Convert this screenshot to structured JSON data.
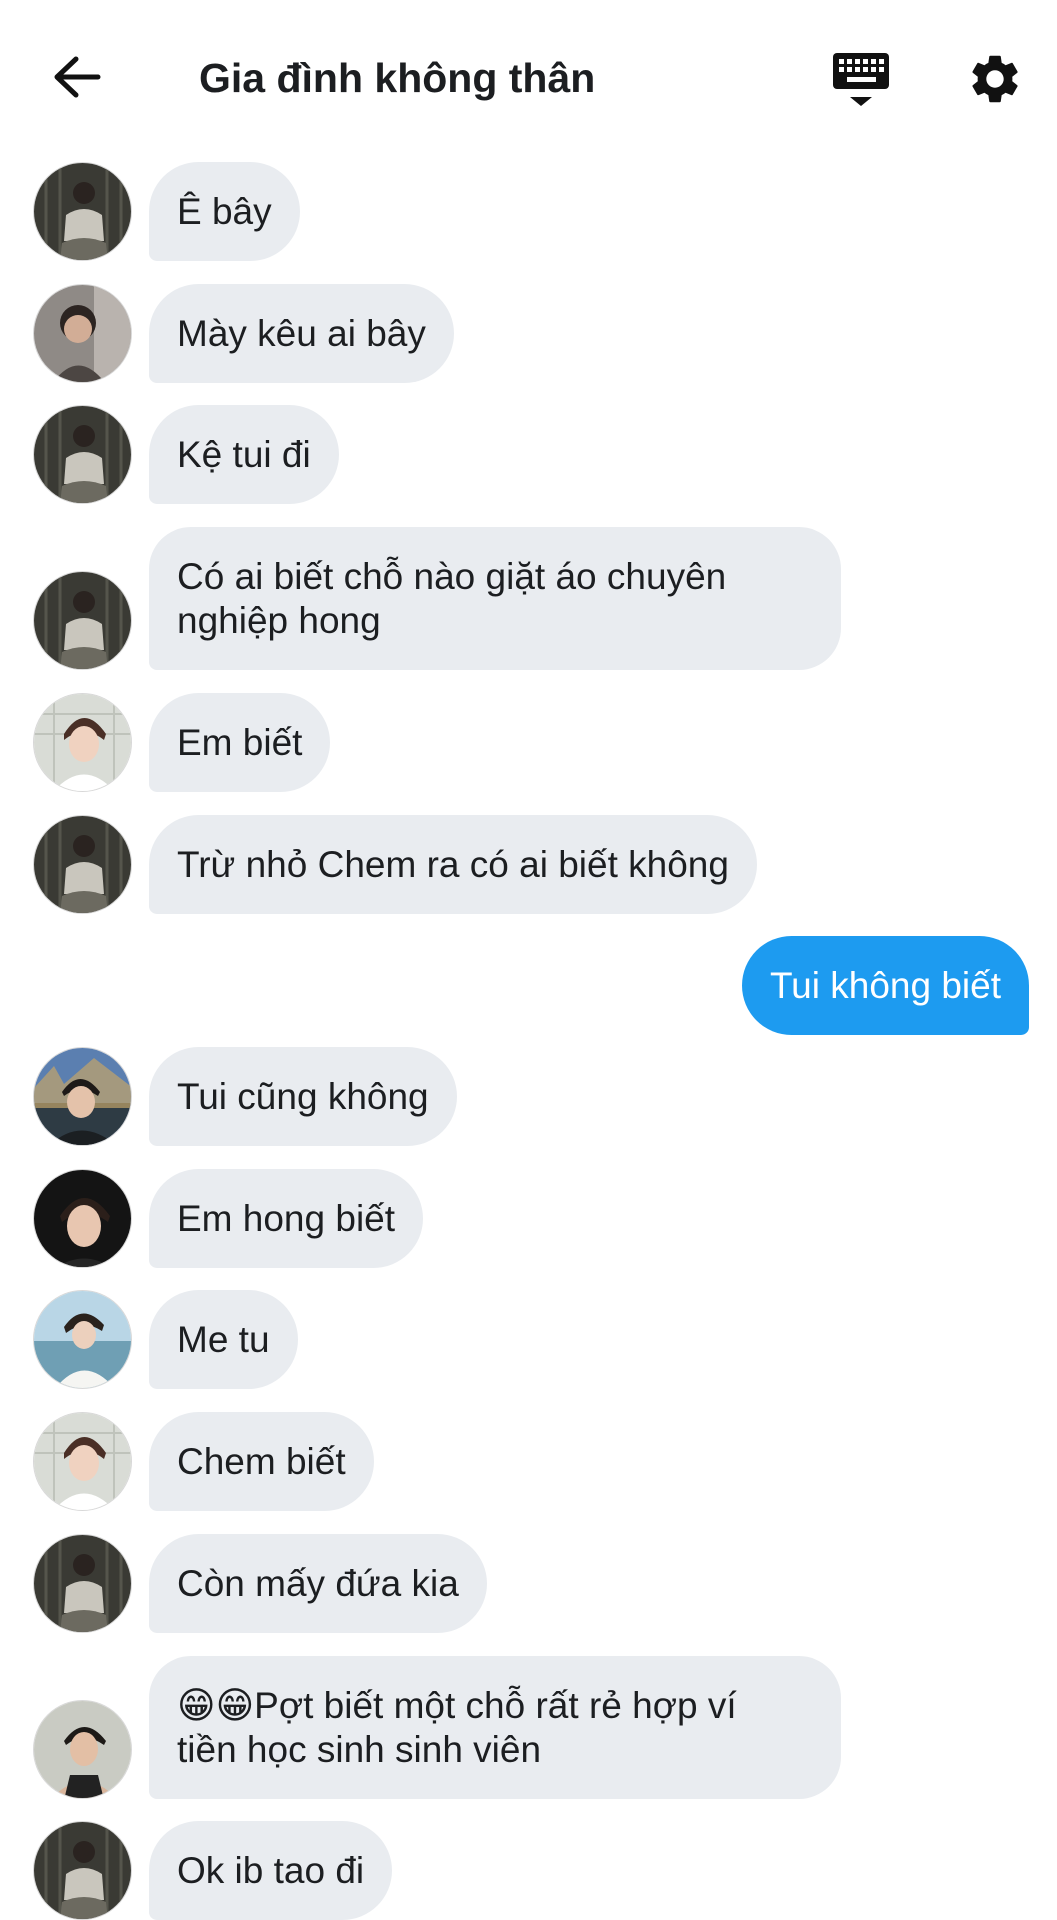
{
  "header": {
    "title": "Gia đình không thân",
    "back_icon": "arrow-left-icon",
    "keyboard_icon": "keyboard-icon",
    "settings_icon": "gear-icon"
  },
  "colors": {
    "incoming_bubble": "#e9ecf0",
    "outgoing_bubble": "#1d9bf0"
  },
  "messages": [
    {
      "text": "Ê bây",
      "avatar": "avatar-a"
    },
    {
      "text": "Mày kêu ai bây",
      "avatar": "avatar-b"
    },
    {
      "text": "Kệ tui đi",
      "avatar": "avatar-a"
    },
    {
      "line1": "Có ai biết chỗ nào giặt áo chuyên",
      "line2": "nghiệp hong",
      "avatar": "avatar-a"
    },
    {
      "text": "Em biết",
      "avatar": "avatar-c"
    },
    {
      "text": "Trừ nhỏ Chem ra có ai biết không",
      "avatar": "avatar-a"
    },
    {
      "text": "Tui không biết",
      "outgoing": true
    },
    {
      "text": "Tui cũng không",
      "avatar": "avatar-d"
    },
    {
      "text": "Em hong biết",
      "avatar": "avatar-e"
    },
    {
      "text": "Me tu",
      "avatar": "avatar-f"
    },
    {
      "text": "Chem biết",
      "avatar": "avatar-c"
    },
    {
      "text": "Còn mấy đứa kia",
      "avatar": "avatar-a"
    },
    {
      "emoji": "😁😁",
      "line1": "Pợt biết một chỗ rất rẻ hợp ví",
      "line2": "tiền học sinh sinh viên",
      "avatar": "avatar-g"
    },
    {
      "text": "Ok ib tao đi",
      "avatar": "avatar-a"
    }
  ]
}
